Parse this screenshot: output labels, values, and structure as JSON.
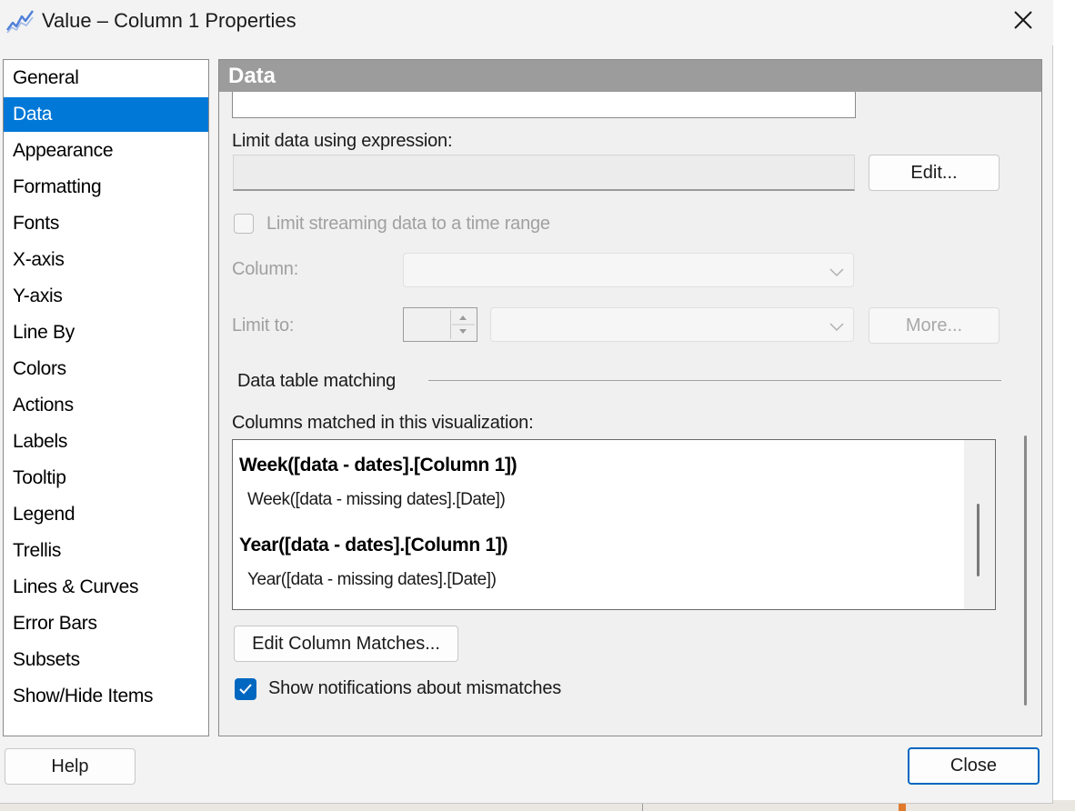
{
  "window": {
    "title": "Value – Column 1 Properties"
  },
  "nav": {
    "items": [
      "General",
      "Data",
      "Appearance",
      "Formatting",
      "Fonts",
      "X-axis",
      "Y-axis",
      "Line By",
      "Colors",
      "Actions",
      "Labels",
      "Tooltip",
      "Legend",
      "Trellis",
      "Lines & Curves",
      "Error Bars",
      "Subsets",
      "Show/Hide Items"
    ],
    "selected": "Data"
  },
  "panel": {
    "header": "Data",
    "limit_expression_label": "Limit data using expression:",
    "limit_expression_value": "",
    "edit_button": "Edit...",
    "limit_streaming_label": "Limit streaming data to a time range",
    "limit_streaming_checked": false,
    "column_label": "Column:",
    "column_value": "",
    "limit_to_label": "Limit to:",
    "limit_to_value": "",
    "more_button": "More...",
    "data_table_matching_label": "Data table matching",
    "columns_matched_label": "Columns matched in this visualization:",
    "matches": [
      {
        "main": "Week([data - dates].[Column 1])",
        "sub": "Week([data - missing dates].[Date])"
      },
      {
        "main": "Year([data - dates].[Column 1])",
        "sub": "Year([data - missing dates].[Date])"
      }
    ],
    "edit_column_matches_button": "Edit Column Matches...",
    "show_notifications_label": "Show notifications about mismatches",
    "show_notifications_checked": true
  },
  "footer": {
    "help_button": "Help",
    "close_button": "Close"
  },
  "colors": {
    "accent": "#0078d7",
    "header_bg": "#9c9c9c",
    "checkbox": "#0067c0"
  },
  "icons": {
    "app": "line-chart-icon",
    "close": "close-icon"
  }
}
